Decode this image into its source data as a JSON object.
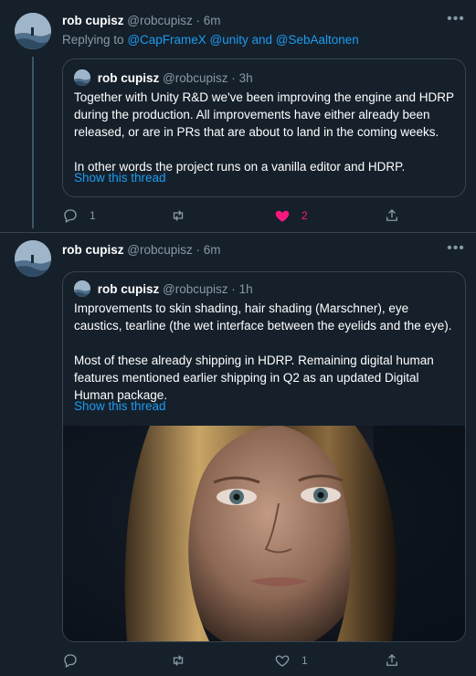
{
  "tweets": [
    {
      "author_name": "rob cupisz",
      "handle": "@robcupisz",
      "separator": "·",
      "time": "6m",
      "replying_to_prefix": "Replying to",
      "replying_to": "@CapFrameX @unity and @SebAaltonen",
      "quote": {
        "author_name": "rob cupisz",
        "handle": "@robcupisz",
        "separator": "·",
        "time": "3h",
        "paragraph1": "Together with Unity R&D we've been improving the engine and HDRP during the production. All improvements have either already been released, or are in PRs that are about to land in the coming weeks.",
        "paragraph2": "In other words the project runs on a vanilla editor and HDRP.",
        "show_thread": "Show this thread"
      },
      "actions": {
        "replies": "1",
        "retweets": "",
        "likes": "2",
        "liked": true
      }
    },
    {
      "author_name": "rob cupisz",
      "handle": "@robcupisz",
      "separator": "·",
      "time": "6m",
      "quote": {
        "author_name": "rob cupisz",
        "handle": "@robcupisz",
        "separator": "·",
        "time": "1h",
        "paragraph1": "Improvements to skin shading, hair shading (Marschner), eye caustics, tearline (the wet interface between the eyelids and the eye).",
        "paragraph2": "Most of these already shipping in HDRP. Remaining digital human features mentioned earlier shipping in Q2 as an updated Digital Human package.",
        "show_thread": "Show this thread"
      },
      "actions": {
        "replies": "",
        "retweets": "",
        "likes": "1",
        "liked": false
      }
    }
  ],
  "colors": {
    "background": "#15202b",
    "border": "#38444d",
    "muted": "#8899a6",
    "link": "#1d9bf0",
    "like": "#f91880"
  },
  "icons": [
    "more-icon",
    "reply-icon",
    "retweet-icon",
    "like-icon",
    "share-icon"
  ]
}
